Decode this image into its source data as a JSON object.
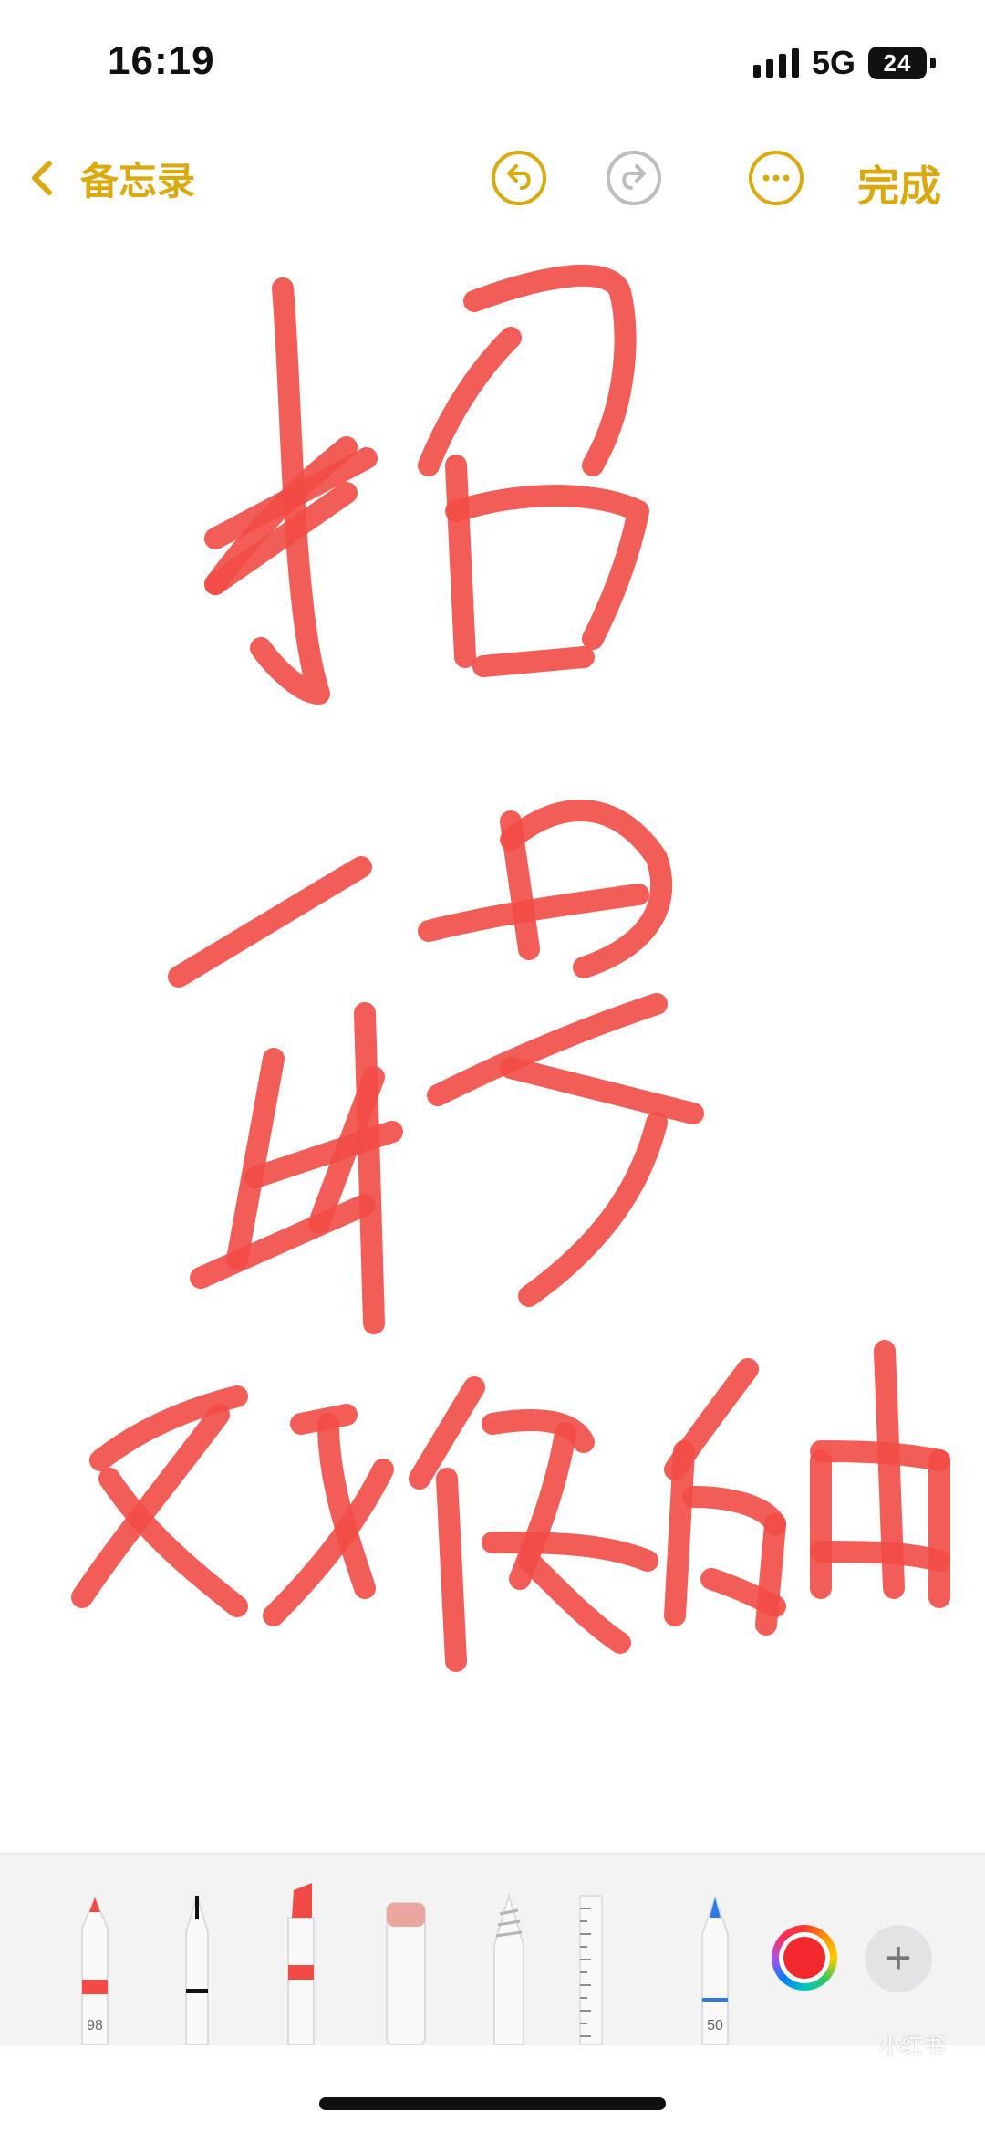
{
  "status_bar": {
    "time": "16:19",
    "network": "5G",
    "battery": "24"
  },
  "nav": {
    "back_label": "备忘录",
    "done_label": "完成",
    "undo_icon": "undo-icon",
    "redo_icon": "redo-icon",
    "more_icon": "more-icon"
  },
  "drawing": {
    "handwritten_text": "招聘双保触",
    "ink_color": "#f24b46"
  },
  "tools": {
    "pen": {
      "name": "pen",
      "label": "98"
    },
    "fineliner": {
      "name": "fineliner"
    },
    "marker": {
      "name": "marker"
    },
    "eraser": {
      "name": "eraser"
    },
    "lasso": {
      "name": "lasso"
    },
    "ruler": {
      "name": "ruler"
    },
    "pencil": {
      "name": "pencil",
      "label": "50"
    },
    "color": {
      "name": "color-picker",
      "value": "#f2282c"
    },
    "add": {
      "label": "+"
    }
  },
  "watermark": {
    "text": "小红书",
    "id": ""
  },
  "colors": {
    "accent": "#d9a90e",
    "ink": "#f24b46",
    "selected": "#f2282c"
  }
}
